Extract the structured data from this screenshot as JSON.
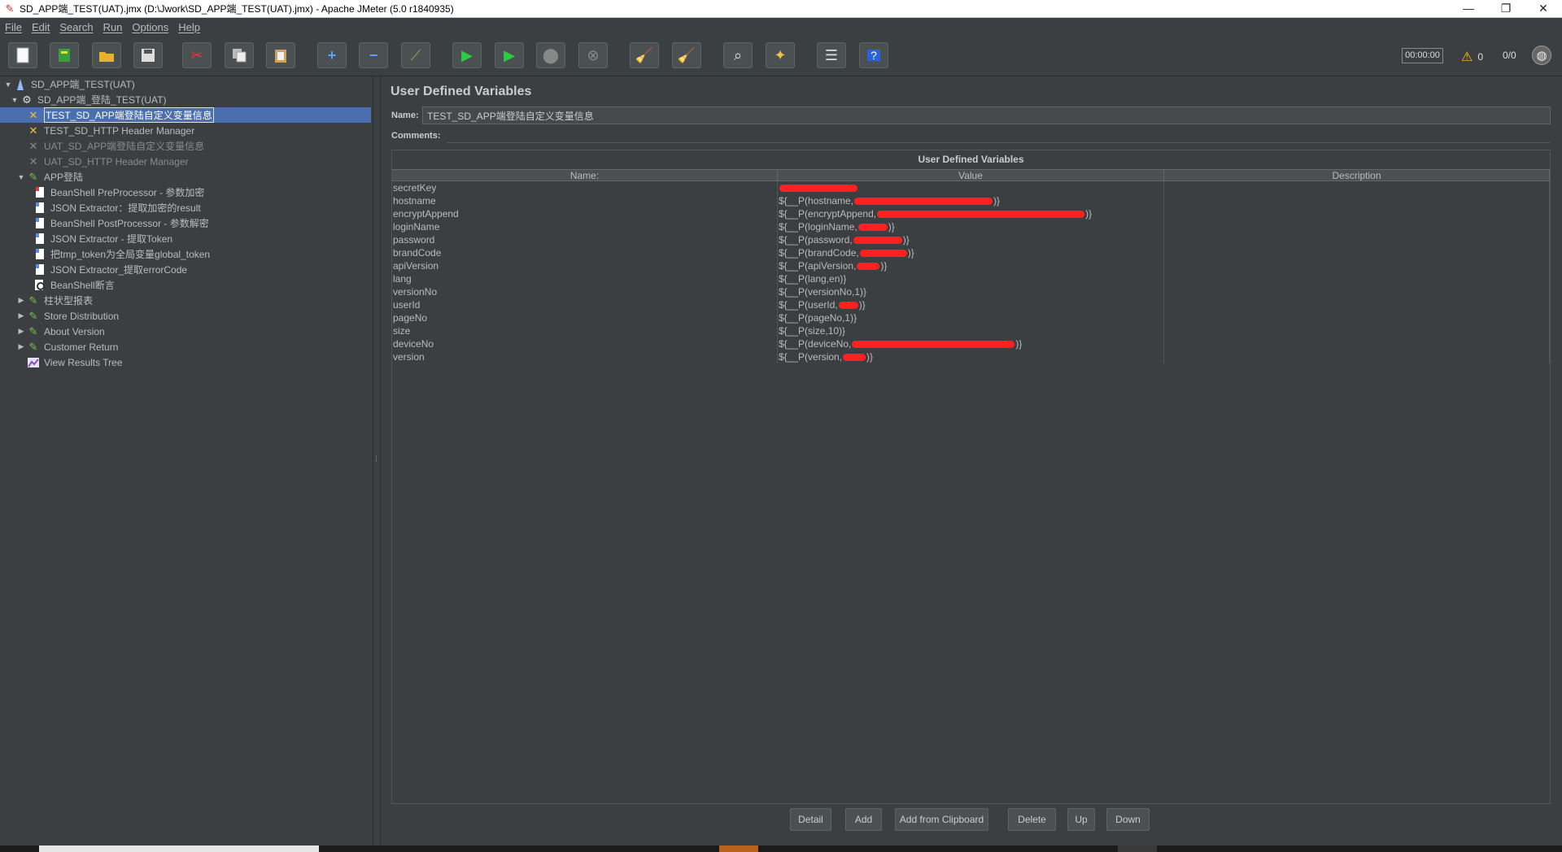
{
  "window": {
    "title": "SD_APP端_TEST(UAT).jmx (D:\\Jwork\\SD_APP端_TEST(UAT).jmx) - Apache JMeter (5.0 r1840935)",
    "controls": [
      "—",
      "❐",
      "✕"
    ]
  },
  "menu": [
    "File",
    "Edit",
    "Search",
    "Run",
    "Options",
    "Help"
  ],
  "toolbar": {
    "timer": "00:00:00",
    "warnings": "0",
    "threads": "0/0"
  },
  "tree": [
    {
      "label": "SD_APP端_TEST(UAT)",
      "icon": "test-plan-icon",
      "toggle": "expanded"
    },
    {
      "label": "SD_APP端_登陆_TEST(UAT)",
      "icon": "thread-group-icon",
      "toggle": "expanded"
    },
    {
      "label": "TEST_SD_APP端登陆自定义变量信息",
      "icon": "config-element-icon",
      "toggle": "none"
    },
    {
      "label": "TEST_SD_HTTP Header Manager",
      "icon": "config-element-icon",
      "toggle": "none"
    },
    {
      "label": "UAT_SD_APP端登陆自定义变量信息",
      "icon": "config-element-icon",
      "toggle": "none"
    },
    {
      "label": "UAT_SD_HTTP Header Manager",
      "icon": "config-element-icon",
      "toggle": "none"
    },
    {
      "label": "APP登陆",
      "icon": "sampler-icon",
      "toggle": "expanded"
    },
    {
      "label": "BeanShell PreProcessor - 参数加密",
      "icon": "preprocessor-icon",
      "toggle": "none"
    },
    {
      "label": "JSON Extractor：提取加密的result",
      "icon": "postprocessor-icon",
      "toggle": "none"
    },
    {
      "label": "BeanShell PostProcessor - 参数解密",
      "icon": "postprocessor-icon",
      "toggle": "none"
    },
    {
      "label": "JSON Extractor - 提取Token",
      "icon": "postprocessor-icon",
      "toggle": "none"
    },
    {
      "label": "把tmp_token为全局变量global_token",
      "icon": "postprocessor-icon",
      "toggle": "none"
    },
    {
      "label": "JSON Extractor_提取errorCode",
      "icon": "postprocessor-icon",
      "toggle": "none"
    },
    {
      "label": "BeanShell断言",
      "icon": "assertion-icon",
      "toggle": "none"
    },
    {
      "label": "柱状型报表",
      "icon": "sampler-icon",
      "toggle": "collapsed"
    },
    {
      "label": "Store Distribution",
      "icon": "sampler-icon",
      "toggle": "collapsed"
    },
    {
      "label": "About Version",
      "icon": "sampler-icon",
      "toggle": "collapsed"
    },
    {
      "label": "Customer Return",
      "icon": "sampler-icon",
      "toggle": "collapsed"
    },
    {
      "label": "View Results Tree",
      "icon": "listener-icon",
      "toggle": "none"
    }
  ],
  "panel": {
    "title": "User Defined Variables",
    "name_label": "Name:",
    "name_value": "TEST_SD_APP端登陆自定义变量信息",
    "comments_label": "Comments:",
    "table_caption": "User Defined Variables",
    "columns": [
      "Name:",
      "Value",
      "Description"
    ],
    "rows": [
      {
        "name": "secretKey",
        "value_prefix": "",
        "value_suffix": "",
        "redact_width": 96
      },
      {
        "name": "hostname",
        "value_prefix": "${__P(hostname,",
        "value_suffix": ")}",
        "redact_width": 170
      },
      {
        "name": "encryptAppend",
        "value_prefix": "${__P(encryptAppend,",
        "value_suffix": ")}",
        "redact_width": 255
      },
      {
        "name": "loginName",
        "value_prefix": "${__P(loginName,",
        "value_suffix": ")}",
        "redact_width": 36
      },
      {
        "name": "password",
        "value_prefix": "${__P(password,",
        "value_suffix": ")}",
        "redact_width": 60
      },
      {
        "name": "brandCode",
        "value_prefix": "${__P(brandCode,",
        "value_suffix": ")}",
        "redact_width": 58
      },
      {
        "name": "apiVersion",
        "value_prefix": "${__P(apiVersion,",
        "value_suffix": ")}",
        "redact_width": 28
      },
      {
        "name": "lang",
        "value_prefix": "${__P(lang,en)}",
        "value_suffix": "",
        "redact_width": 0
      },
      {
        "name": "versionNo",
        "value_prefix": "${__P(versionNo,1)}",
        "value_suffix": "",
        "redact_width": 0
      },
      {
        "name": "userId",
        "value_prefix": "${__P(userId,",
        "value_suffix": ")}",
        "redact_width": 24
      },
      {
        "name": "pageNo",
        "value_prefix": "${__P(pageNo,1)}",
        "value_suffix": "",
        "redact_width": 0
      },
      {
        "name": "size",
        "value_prefix": "${__P(size,10)}",
        "value_suffix": "",
        "redact_width": 0
      },
      {
        "name": "deviceNo",
        "value_prefix": "${__P(deviceNo,",
        "value_suffix": ")}",
        "redact_width": 200
      },
      {
        "name": "version",
        "value_prefix": "${__P(version,",
        "value_suffix": ")}",
        "redact_width": 28
      }
    ],
    "buttons": [
      "Detail",
      "Add",
      "Add from Clipboard",
      "Delete",
      "Up",
      "Down"
    ]
  },
  "colors": {
    "background": "#3c3f41",
    "selection": "#4b6eaf",
    "redaction": "#ff2020"
  }
}
